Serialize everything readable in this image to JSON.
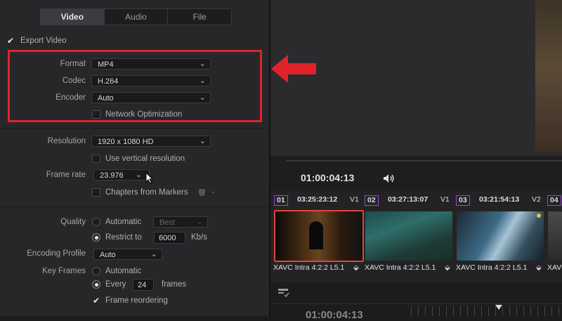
{
  "tabs": [
    "Video",
    "Audio",
    "File"
  ],
  "export_video": {
    "label": "Export Video",
    "checked": true
  },
  "format": {
    "label": "Format",
    "value": "MP4"
  },
  "codec": {
    "label": "Codec",
    "value": "H.264"
  },
  "encoder": {
    "label": "Encoder",
    "value": "Auto"
  },
  "network_optimization": {
    "label": "Network Optimization",
    "checked": false
  },
  "resolution": {
    "label": "Resolution",
    "value": "1920 x 1080 HD"
  },
  "vertical_resolution": {
    "label": "Use vertical resolution",
    "checked": false
  },
  "frame_rate": {
    "label": "Frame rate",
    "value": "23.976"
  },
  "chapters": {
    "label": "Chapters from Markers",
    "checked": false
  },
  "quality": {
    "label": "Quality",
    "automatic_label": "Automatic",
    "automatic_value": "Best",
    "restrict_label": "Restrict to",
    "restrict_value": "6000",
    "unit": "Kb/s",
    "selected": "restrict"
  },
  "encoding_profile": {
    "label": "Encoding Profile",
    "value": "Auto"
  },
  "key_frames": {
    "label": "Key Frames",
    "automatic_label": "Automatic",
    "every_label": "Every",
    "every_value": "24",
    "unit": "frames",
    "selected": "every"
  },
  "frame_reordering": {
    "label": "Frame reordering",
    "checked": true
  },
  "accent_color": "#e0232b",
  "timeline": {
    "timecode": "01:00:04:13",
    "bottom_timecode": "01:00:04:13",
    "clips": [
      {
        "num": "01",
        "tc": "03:25:23:12",
        "track": "V1",
        "name": "XAVC Intra 4:2:2 L5.1",
        "color": "#a64fe0"
      },
      {
        "num": "02",
        "tc": "03:27:13:07",
        "track": "V1",
        "name": "XAVC Intra 4:2:2 L5.1",
        "color": "#a64fe0"
      },
      {
        "num": "03",
        "tc": "03:21:54:13",
        "track": "V2",
        "name": "XAVC Intra 4:2:2 L5.1",
        "color": "#a64fe0"
      },
      {
        "num": "04",
        "tc": "",
        "track": "",
        "name": "XAVC I",
        "color": "#a64fe0"
      }
    ]
  }
}
